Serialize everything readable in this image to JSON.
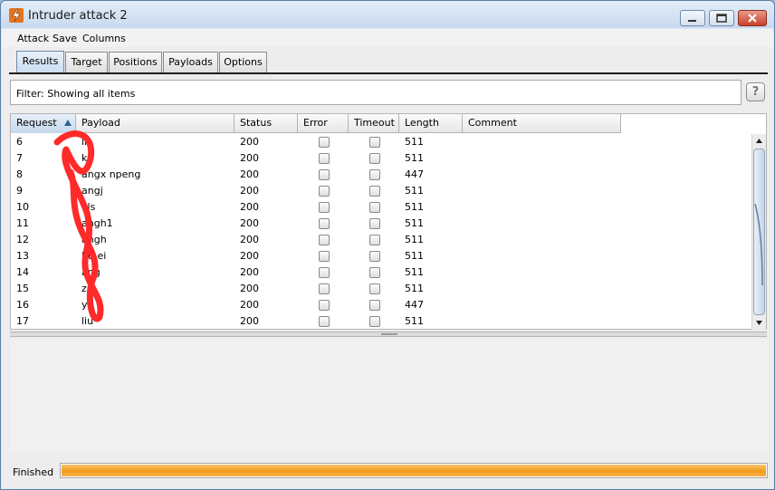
{
  "window": {
    "title": "Intruder attack 2",
    "controls": [
      "minimize",
      "maximize",
      "close"
    ]
  },
  "menu": [
    "Attack",
    "Save",
    "Columns"
  ],
  "tabs": [
    {
      "label": "Results",
      "active": true
    },
    {
      "label": "Target",
      "active": false
    },
    {
      "label": "Positions",
      "active": false
    },
    {
      "label": "Payloads",
      "active": false
    },
    {
      "label": "Options",
      "active": false
    }
  ],
  "filter": {
    "text": "Filter:  Showing all items",
    "help_label": "?"
  },
  "table": {
    "columns": [
      "Request",
      "Payload",
      "Status",
      "Error",
      "Timeout",
      "Length",
      "Comment"
    ],
    "sorted_column": "Request",
    "rows": [
      {
        "request": "6",
        "payload": "li",
        "status": "200",
        "error": false,
        "timeout": false,
        "length": "511",
        "comment": ""
      },
      {
        "request": "7",
        "payload": "kl",
        "status": "200",
        "error": false,
        "timeout": false,
        "length": "511",
        "comment": ""
      },
      {
        "request": "8",
        "payload": "angx   npeng",
        "status": "200",
        "error": false,
        "timeout": false,
        "length": "447",
        "comment": ""
      },
      {
        "request": "9",
        "payload": "angj",
        "status": "200",
        "error": false,
        "timeout": false,
        "length": "511",
        "comment": ""
      },
      {
        "request": "10",
        "payload": "vls",
        "status": "200",
        "error": false,
        "timeout": false,
        "length": "511",
        "comment": ""
      },
      {
        "request": "11",
        "payload": "angh1",
        "status": "200",
        "error": false,
        "timeout": false,
        "length": "511",
        "comment": ""
      },
      {
        "request": "12",
        "payload": "angh",
        "status": "200",
        "error": false,
        "timeout": false,
        "length": "511",
        "comment": ""
      },
      {
        "request": "13",
        "payload": "hu   ei",
        "status": "200",
        "error": false,
        "timeout": false,
        "length": "511",
        "comment": ""
      },
      {
        "request": "14",
        "payload": "ang",
        "status": "200",
        "error": false,
        "timeout": false,
        "length": "511",
        "comment": ""
      },
      {
        "request": "15",
        "payload": "z",
        "status": "200",
        "error": false,
        "timeout": false,
        "length": "511",
        "comment": ""
      },
      {
        "request": "16",
        "payload": "y",
        "status": "200",
        "error": false,
        "timeout": false,
        "length": "447",
        "comment": ""
      },
      {
        "request": "17",
        "payload": "liu",
        "status": "200",
        "error": false,
        "timeout": false,
        "length": "511",
        "comment": ""
      }
    ]
  },
  "status": {
    "text": "Finished",
    "progress": 1.0
  },
  "colors": {
    "progress": "#f39c1d",
    "scribble": "#ff2a2a",
    "sort_arrow": "#2f5f93"
  },
  "icons": {
    "app": "burp-lightning-icon",
    "sort": "sort-ascending-icon",
    "help": "help-icon",
    "scroll_up": "arrow-up-icon",
    "scroll_down": "arrow-down-icon"
  }
}
